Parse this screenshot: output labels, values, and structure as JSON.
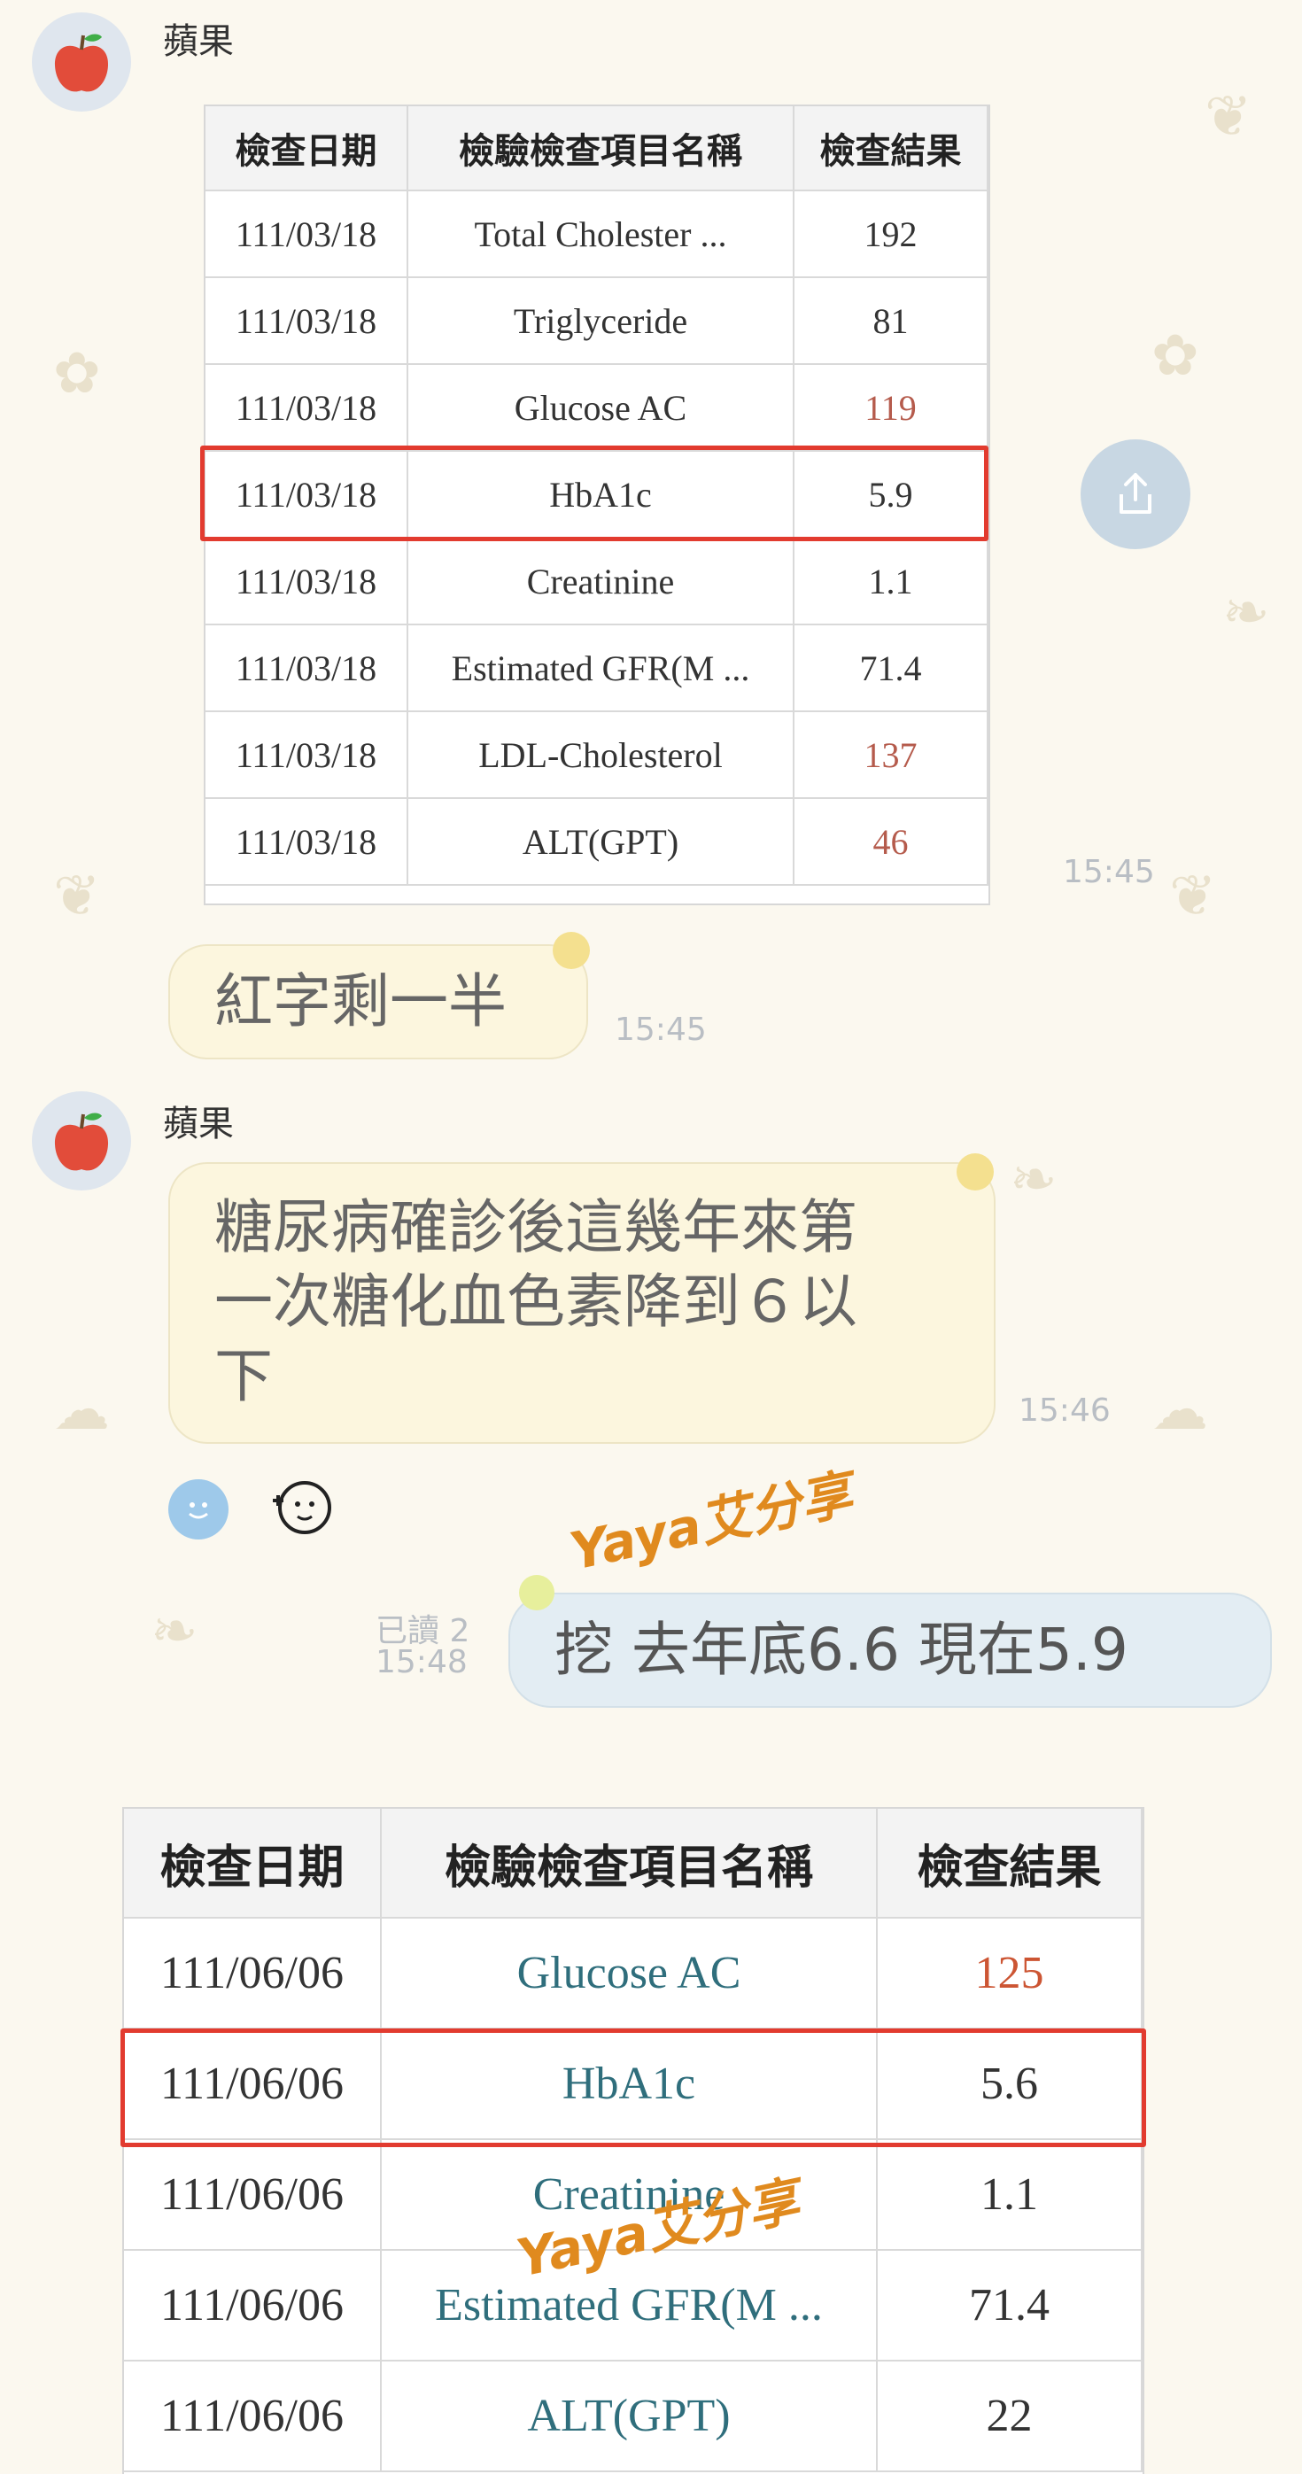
{
  "chat": {
    "sender_name": "蘋果",
    "sender_name_2": "蘋果",
    "first_table": {
      "headers": [
        "檢查日期",
        "檢驗檢查項目名稱",
        "檢查結果"
      ],
      "rows": [
        [
          "111/03/18",
          "Total Cholester ...",
          "192"
        ],
        [
          "111/03/18",
          "Triglyceride",
          "81"
        ],
        [
          "111/03/18",
          "Glucose AC",
          "119"
        ],
        [
          "111/03/18",
          "HbA1c",
          "5.9"
        ],
        [
          "111/03/18",
          "Creatinine",
          "1.1"
        ],
        [
          "111/03/18",
          "Estimated GFR(M ...",
          "71.4"
        ],
        [
          "111/03/18",
          "LDL-Cholesterol",
          "137"
        ],
        [
          "111/03/18",
          "ALT(GPT)",
          "46"
        ]
      ],
      "time": "15:45"
    },
    "msg_half": {
      "text": "紅字剩一半",
      "time": "15:45"
    },
    "msg_diabetes": {
      "line1": "糖尿病確診後這幾年來第",
      "line2": "一次糖化血色素降到６以",
      "line3": "下",
      "time": "15:46"
    },
    "my_msg": {
      "read": "已讀 2",
      "time": "15:48",
      "text": "挖 去年底6.6  現在5.9"
    },
    "watermark": "Yaya艾分享",
    "second_table": {
      "headers": [
        "檢查日期",
        "檢驗檢查項目名稱",
        "檢查結果"
      ],
      "rows": [
        [
          "111/06/06",
          "Glucose AC",
          "125"
        ],
        [
          "111/06/06",
          "HbA1c",
          "5.6"
        ],
        [
          "111/06/06",
          "Creatinine",
          "1.1"
        ],
        [
          "111/06/06",
          "Estimated GFR(M ...",
          "71.4"
        ],
        [
          "111/06/06",
          "ALT(GPT)",
          "22"
        ]
      ]
    },
    "colors": {
      "highlight": "#e23b2f",
      "abnormal": "#b55b4c",
      "bubble": "#fcf6de",
      "mine": "#e3edf3"
    }
  }
}
